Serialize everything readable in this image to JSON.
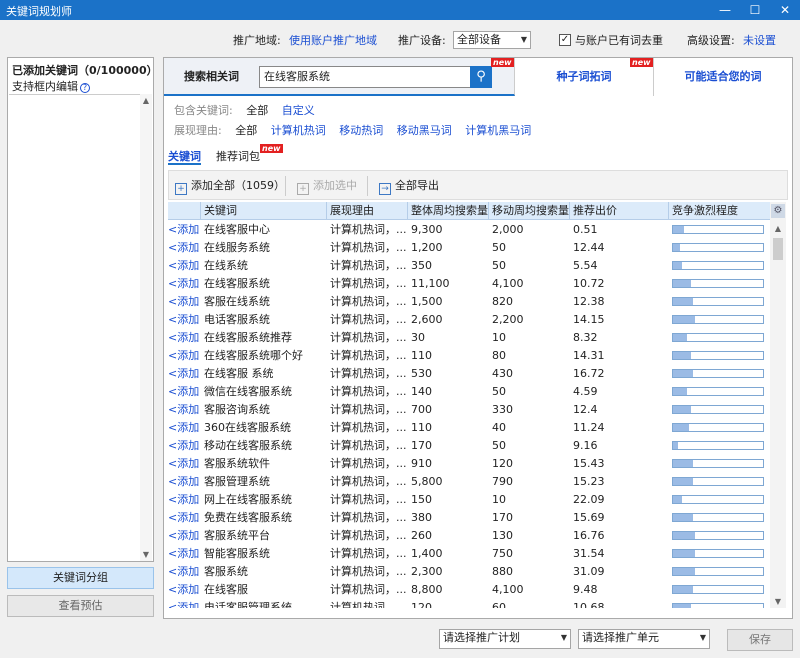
{
  "window": {
    "title": "关键词规划师",
    "minimize_glyph": "—",
    "maximize_glyph": "☐",
    "close_glyph": "✕"
  },
  "settings": {
    "region_label": "推广地域:",
    "region_value": "使用账户推广地域",
    "device_label": "推广设备:",
    "device_value": "全部设备",
    "dedupe_checked": true,
    "dedupe_label": "与账户已有词去重",
    "advanced_label": "高级设置:",
    "advanced_value": "未设置"
  },
  "left_panel": {
    "title": "已添加关键词（0/100000）",
    "subtitle": "支持框内编辑",
    "help_glyph": "?",
    "group_button": "关键词分组",
    "preview_button": "查看预估"
  },
  "top_tabs": [
    {
      "label": "搜索相关词",
      "active": true,
      "new": true
    },
    {
      "label": "种子词拓词",
      "active": false,
      "new": true
    },
    {
      "label": "可能适合您的词",
      "active": false,
      "new": false
    }
  ],
  "new_badge": "new",
  "search": {
    "value": "在线客服系统",
    "icon": "magnifier-icon"
  },
  "filters": {
    "include_label": "包含关键词:",
    "include_options": [
      "全部",
      "自定义"
    ],
    "reason_label": "展现理由:",
    "reason_options": [
      "全部",
      "计算机热词",
      "移动热词",
      "移动黑马词",
      "计算机黑马词"
    ]
  },
  "sub_tabs": [
    {
      "label": "关键词",
      "active": true
    },
    {
      "label": "推荐词包",
      "active": false,
      "new": true
    }
  ],
  "toolbar": {
    "add_all": "添加全部（1059）",
    "add_selected": "添加选中",
    "export_all": "全部导出"
  },
  "table": {
    "columns": [
      "",
      "关键词",
      "展现理由",
      "整体周均搜索量",
      "移动周均搜索量",
      "推荐出价",
      "竞争激烈程度"
    ],
    "add_text": "<添加",
    "rows": [
      {
        "keyword": "在线客服中心",
        "reason": "计算机热词，...",
        "total": "9,300",
        "mobile": "2,000",
        "bid": "0.51",
        "competition": 0.12
      },
      {
        "keyword": "在线服务系统",
        "reason": "计算机热词，...",
        "total": "1,200",
        "mobile": "50",
        "bid": "12.44",
        "competition": 0.08
      },
      {
        "keyword": "在线系统",
        "reason": "计算机热词，...",
        "total": "350",
        "mobile": "50",
        "bid": "5.54",
        "competition": 0.1
      },
      {
        "keyword": "在线客服系统",
        "reason": "计算机热词，...",
        "total": "11,100",
        "mobile": "4,100",
        "bid": "10.72",
        "competition": 0.2
      },
      {
        "keyword": "客服在线系统",
        "reason": "计算机热词，...",
        "total": "1,500",
        "mobile": "820",
        "bid": "12.38",
        "competition": 0.22
      },
      {
        "keyword": "电话客服系统",
        "reason": "计算机热词，...",
        "total": "2,600",
        "mobile": "2,200",
        "bid": "14.15",
        "competition": 0.24
      },
      {
        "keyword": "在线客服系统推荐",
        "reason": "计算机热词，...",
        "total": "30",
        "mobile": "10",
        "bid": "8.32",
        "competition": 0.16
      },
      {
        "keyword": "在线客服系统哪个好",
        "reason": "计算机热词，...",
        "total": "110",
        "mobile": "80",
        "bid": "14.31",
        "competition": 0.2
      },
      {
        "keyword": "在线客服 系统",
        "reason": "计算机热词，...",
        "total": "530",
        "mobile": "430",
        "bid": "16.72",
        "competition": 0.22
      },
      {
        "keyword": "微信在线客服系统",
        "reason": "计算机热词，...",
        "total": "140",
        "mobile": "50",
        "bid": "4.59",
        "competition": 0.16
      },
      {
        "keyword": "客服咨询系统",
        "reason": "计算机热词，...",
        "total": "700",
        "mobile": "330",
        "bid": "12.4",
        "competition": 0.2
      },
      {
        "keyword": "360在线客服系统",
        "reason": "计算机热词，...",
        "total": "110",
        "mobile": "40",
        "bid": "11.24",
        "competition": 0.18
      },
      {
        "keyword": "移动在线客服系统",
        "reason": "计算机热词，...",
        "total": "170",
        "mobile": "50",
        "bid": "9.16",
        "competition": 0.06
      },
      {
        "keyword": "客服系统软件",
        "reason": "计算机热词，...",
        "total": "910",
        "mobile": "120",
        "bid": "15.43",
        "competition": 0.22
      },
      {
        "keyword": "客服管理系统",
        "reason": "计算机热词，...",
        "total": "5,800",
        "mobile": "790",
        "bid": "15.23",
        "competition": 0.22
      },
      {
        "keyword": "网上在线客服系统",
        "reason": "计算机热词，...",
        "total": "150",
        "mobile": "10",
        "bid": "22.09",
        "competition": 0.1
      },
      {
        "keyword": "免费在线客服系统",
        "reason": "计算机热词，...",
        "total": "380",
        "mobile": "170",
        "bid": "15.69",
        "competition": 0.22
      },
      {
        "keyword": "客服系统平台",
        "reason": "计算机热词，...",
        "total": "260",
        "mobile": "130",
        "bid": "16.76",
        "competition": 0.24
      },
      {
        "keyword": "智能客服系统",
        "reason": "计算机热词，...",
        "total": "1,400",
        "mobile": "750",
        "bid": "31.54",
        "competition": 0.24
      },
      {
        "keyword": "客服系统",
        "reason": "计算机热词，...",
        "total": "2,300",
        "mobile": "880",
        "bid": "31.09",
        "competition": 0.24
      },
      {
        "keyword": "在线客服",
        "reason": "计算机热词，...",
        "total": "8,800",
        "mobile": "4,100",
        "bid": "9.48",
        "competition": 0.22
      },
      {
        "keyword": "电话客服管理系统",
        "reason": "计算机热词，...",
        "total": "120",
        "mobile": "60",
        "bid": "10.68",
        "competition": 0.2
      }
    ]
  },
  "bottom": {
    "plan_select": "请选择推广计划",
    "unit_select": "请选择推广单元",
    "save": "保存"
  }
}
